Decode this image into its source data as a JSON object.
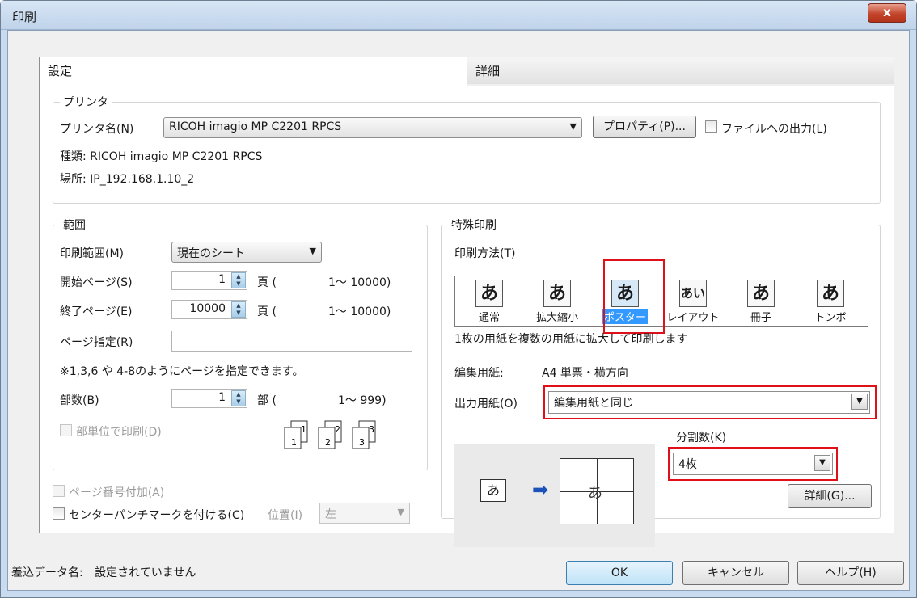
{
  "window": {
    "title": "印刷",
    "close_glyph": "x"
  },
  "tabs": {
    "settings": "設定",
    "details": "詳細"
  },
  "printer": {
    "group_title": "プリンタ",
    "name_label": "プリンタ名(N)",
    "name_value": "RICOH imagio MP C2201 RPCS",
    "properties_button": "プロパティ(P)...",
    "print_to_file_label": "ファイルへの出力(L)",
    "type_text": "種類: RICOH imagio MP C2201 RPCS",
    "location_text": "場所: IP_192.168.1.10_2"
  },
  "range": {
    "group_title": "範囲",
    "print_range_label": "印刷範囲(M)",
    "print_range_value": "現在のシート",
    "start_page_label": "開始ページ(S)",
    "start_page_value": "1",
    "page_unit": "頁 (",
    "start_page_range": "1～ 10000)",
    "end_page_label": "終了ページ(E)",
    "end_page_value": "10000",
    "end_page_range": "1～ 10000)",
    "page_spec_label": "ページ指定(R)",
    "page_spec_value": "",
    "page_spec_hint": "※1,3,6 や 4-8のようにページを指定できます。",
    "copies_label": "部数(B)",
    "copies_value": "1",
    "copies_unit": "部 (",
    "copies_range": "1～ 999)",
    "collate_label": "部単位で印刷(D)",
    "collate_digits": [
      "1",
      "1",
      "2",
      "2",
      "3",
      "3"
    ]
  },
  "options": {
    "add_page_number_label": "ページ番号付加(A)",
    "center_punch_label": "センターパンチマークを付ける(C)",
    "position_label": "位置(I)",
    "position_value": "左"
  },
  "special": {
    "group_title": "特殊印刷",
    "method_label": "印刷方法(T)",
    "methods": [
      {
        "label": "通常",
        "glyph": "あ"
      },
      {
        "label": "拡大縮小",
        "glyph": "あ"
      },
      {
        "label": "ポスター",
        "glyph": "あ"
      },
      {
        "label": "レイアウト",
        "glyph": "あい"
      },
      {
        "label": "冊子",
        "glyph": "あ"
      },
      {
        "label": "トンボ",
        "glyph": "あ"
      }
    ],
    "selected_method": "ポスター",
    "description": "1枚の用紙を複数の用紙に拡大して印刷します",
    "edit_paper_label": "編集用紙:",
    "edit_paper_value": "A4 単票・横方向",
    "output_paper_label": "出力用紙(O)",
    "output_paper_value": "編集用紙と同じ",
    "split_label": "分割数(K)",
    "split_value": "4枚",
    "detail_button": "詳細(G)...",
    "preview_glyph": "あ",
    "preview_arrow": "➡"
  },
  "footer": {
    "merge_label": "差込データ名:",
    "merge_value": "設定されていません",
    "ok": "OK",
    "cancel": "キャンセル",
    "help": "ヘルプ(H)"
  },
  "colors": {
    "highlight_box": "#e0101b",
    "selection": "#3399ff",
    "arrow": "#1d52b8"
  }
}
